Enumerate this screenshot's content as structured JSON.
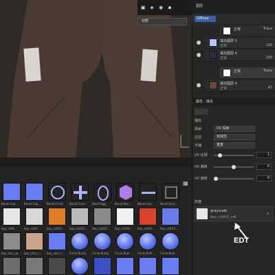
{
  "viewport": {
    "dropdown": "材质",
    "toolbar_icons": [
      "folder-icon",
      "cube-icon",
      "globe-icon",
      "camera-icon"
    ]
  },
  "layers": {
    "panel_title": "图层",
    "channel_select": "Diffuse",
    "items": [
      {
        "name": "正常",
        "blend": "Trace",
        "opacity": "100",
        "indent": true
      },
      {
        "name": "填充图层 5",
        "blend": "正常",
        "opacity": "100",
        "indent": false
      },
      {
        "name": "填充图层 6",
        "blend": "正常",
        "opacity": "100",
        "indent": false
      },
      {
        "name": "正常",
        "blend": "Trace",
        "opacity": "100",
        "indent": true
      },
      {
        "name": "填充图层 4",
        "blend": "正常",
        "opacity": "47",
        "indent": false
      }
    ]
  },
  "properties": {
    "tabs": [
      "属性",
      "填充"
    ],
    "section_fill": "填充",
    "projection_label": "投射",
    "projection_value": "UV 投射",
    "filter_label": "过滤",
    "filter_value": "双线性",
    "tile_label": "平铺",
    "tile_value": "重复",
    "uv_scale_label": "UV 比例",
    "uv_scale_value": "1",
    "uv_offset_label": "UV 偏移",
    "uv_offset_value": "0",
    "uv_rotate_label": "UV 旋转",
    "uv_rotate_value": "0",
    "section_material": "灰度",
    "grayscale_label": "grayscale",
    "grayscale_file": "boy_cloth2_edt"
  },
  "shelf": {
    "row1_labels": [
      "Bevel Cap...",
      "Bevel Cap...",
      "Bevel Circle",
      "Bevel Cross",
      "Bevel Egg",
      "Bevel Hex...",
      "Bevel Line",
      "Bevel Rect..."
    ],
    "row2_labels": [
      "boy_cloth...",
      "boy_cloth...",
      "boy_cloth1...",
      "boy_cloth2...",
      "boy_cloth2...",
      "boy_cloth2...",
      "boy_cloth2...",
      "boy_cloth2..."
    ],
    "row3_labels": [
      "boy_skin_ao",
      "boy_skin_c...",
      "boy_skin_n...",
      "Circle Bump",
      "Circle Bump",
      "Circle Butt...",
      "Circle Butt...",
      "Circle Butt..."
    ]
  },
  "annotation": "EDT"
}
